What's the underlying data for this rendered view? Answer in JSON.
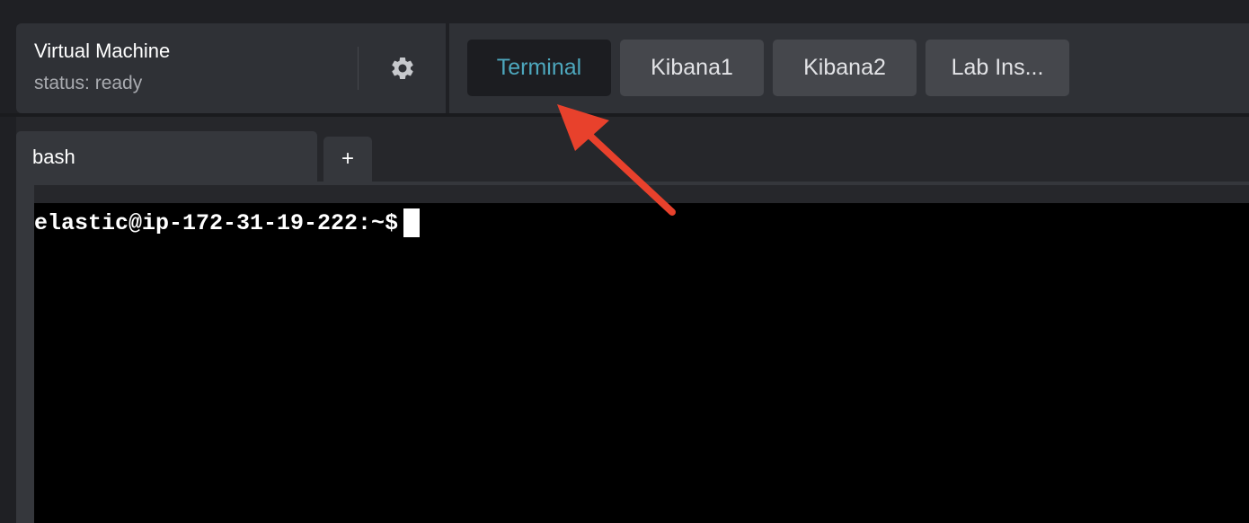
{
  "vm": {
    "title": "Virtual Machine",
    "status": "status: ready"
  },
  "settings": {
    "icon": "gear-icon"
  },
  "tabs": [
    {
      "label": "Terminal",
      "active": true
    },
    {
      "label": "Kibana1",
      "active": false
    },
    {
      "label": "Kibana2",
      "active": false
    },
    {
      "label": "Lab Ins...",
      "active": false
    }
  ],
  "terminal_tabs": {
    "items": [
      {
        "label": "bash"
      }
    ],
    "add_label": "+"
  },
  "terminal": {
    "prompt": "elastic@ip-172-31-19-222:~$"
  },
  "annotation": {
    "icon": "red-arrow-icon",
    "color": "#e8412c"
  },
  "colors": {
    "accent": "#4da7bd",
    "panel": "#2f3136",
    "background": "#1f2024"
  }
}
